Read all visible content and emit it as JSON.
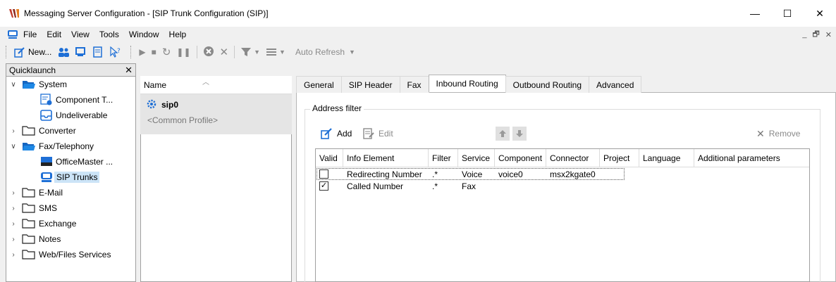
{
  "window": {
    "title": "Messaging Server Configuration - [SIP Trunk Configuration (SIP)]",
    "minimize": "—",
    "maximize": "☐",
    "close": "✕"
  },
  "menu": {
    "items": [
      "File",
      "Edit",
      "View",
      "Tools",
      "Window",
      "Help"
    ],
    "mdi": {
      "minimize": "_",
      "restore": "🗗",
      "close": "✕"
    }
  },
  "toolbar": {
    "new_label": "New...",
    "auto_refresh_label": "Auto Refresh"
  },
  "quicklaunch": {
    "title": "Quicklaunch",
    "close": "✕",
    "tree": [
      {
        "label": "System",
        "expanded": true
      },
      {
        "label": "Component T..."
      },
      {
        "label": "Undeliverable"
      },
      {
        "label": "Converter",
        "expanded": false
      },
      {
        "label": "Fax/Telephony",
        "expanded": true
      },
      {
        "label": "OfficeMaster ..."
      },
      {
        "label": "SIP Trunks",
        "selected": true
      },
      {
        "label": "E-Mail",
        "expanded": false
      },
      {
        "label": "SMS",
        "expanded": false
      },
      {
        "label": "Exchange",
        "expanded": false
      },
      {
        "label": "Notes",
        "expanded": false
      },
      {
        "label": "Web/Files Services",
        "expanded": false
      }
    ]
  },
  "list": {
    "header": "Name",
    "item_name": "sip0",
    "item_profile": "<Common Profile>"
  },
  "tabs": [
    "General",
    "SIP Header",
    "Fax",
    "Inbound Routing",
    "Outbound Routing",
    "Advanced"
  ],
  "active_tab": "Inbound Routing",
  "address_filter": {
    "title": "Address filter",
    "add_label": "Add",
    "edit_label": "Edit",
    "remove_label": "Remove",
    "columns": [
      "Valid",
      "Info Element",
      "Filter",
      "Service",
      "Component",
      "Connector",
      "Project",
      "Language",
      "Additional parameters"
    ],
    "rows": [
      {
        "valid": false,
        "info_element": "Redirecting Number",
        "filter": ".*",
        "service": "Voice",
        "component": "voice0",
        "connector": "msx2kgate0",
        "project": "",
        "language": "",
        "params": ""
      },
      {
        "valid": true,
        "info_element": "Called Number",
        "filter": ".*",
        "service": "Fax",
        "component": "",
        "connector": "",
        "project": "",
        "language": "",
        "params": ""
      }
    ]
  },
  "colors": {
    "accent_blue": "#1e6fd6",
    "selection": "#cce4f7",
    "folder_blue": "#1565c0"
  }
}
